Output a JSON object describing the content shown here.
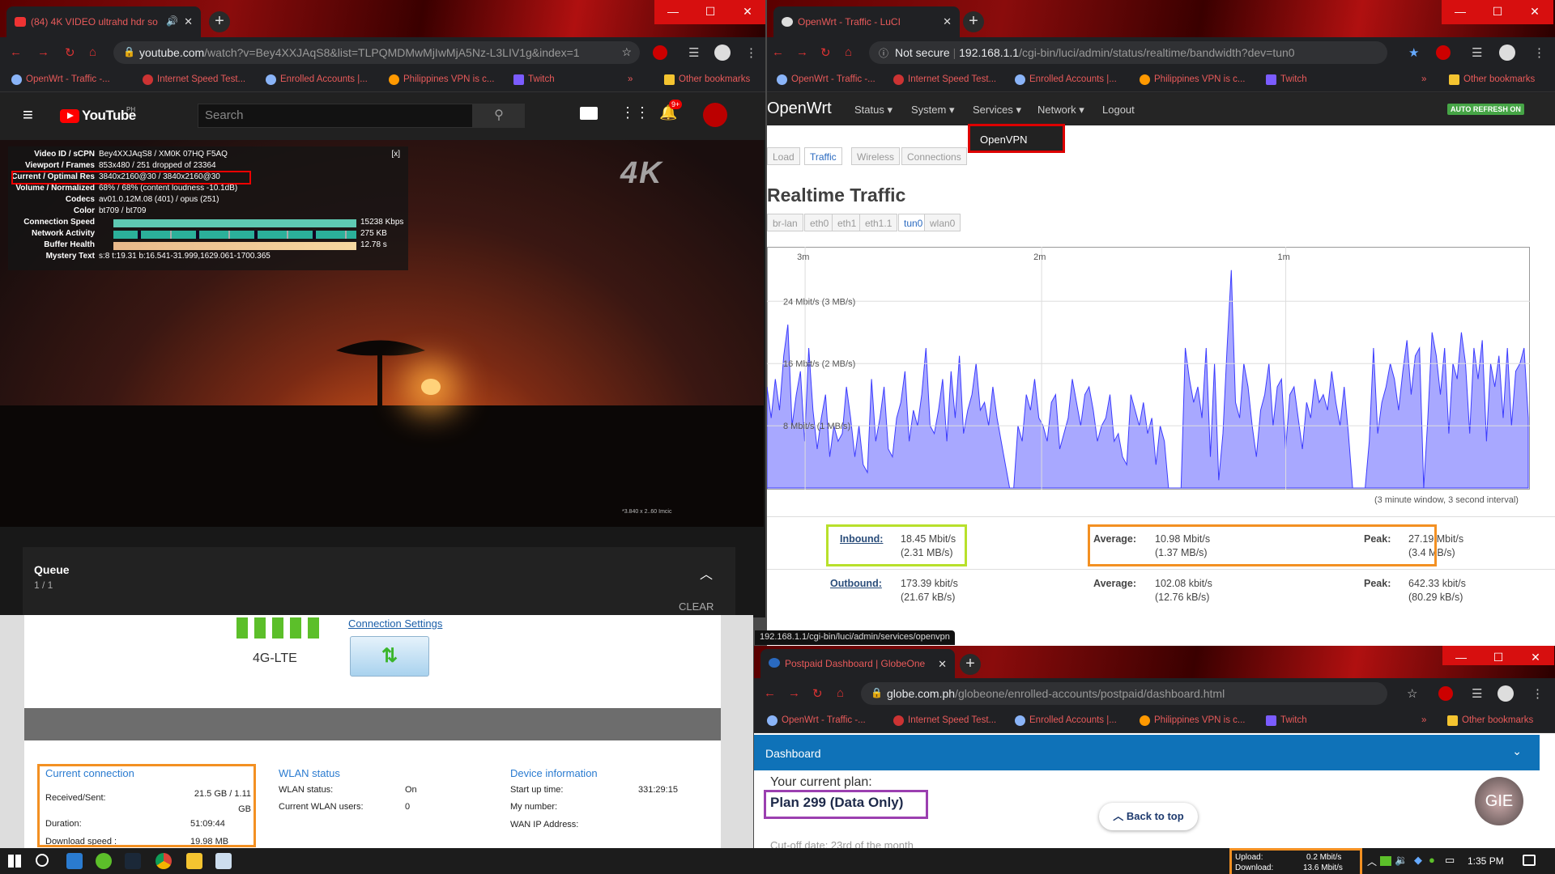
{
  "youtube_window": {
    "tab_title": "(84) 4K VIDEO ultrahd hdr so",
    "url_host": "youtube.com",
    "url_path": "/watch?v=Bey4XXJAqS8&list=TLPQMDMwMjIwMjA5Nz-L3LIV1g&index=1",
    "brand": "YouTube",
    "brand_region": "PH",
    "search_placeholder": "Search",
    "notification_badge": "9+",
    "video_badge": "4K",
    "video_info_close": "[x]",
    "video_footer_note": "*3.840 x 2..60 Imcic",
    "stats": [
      {
        "label": "Video ID / sCPN",
        "value": "Bey4XXJAqS8 / XM0K 07HQ F5AQ"
      },
      {
        "label": "Viewport / Frames",
        "value": "853x480 / 251 dropped of 23364"
      },
      {
        "label": "Current / Optimal Res",
        "value": "3840x2160@30 / 3840x2160@30"
      },
      {
        "label": "Volume / Normalized",
        "value": "68% / 68% (content loudness -10.1dB)"
      },
      {
        "label": "Codecs",
        "value": "av01.0.12M.08 (401) / opus (251)"
      },
      {
        "label": "Color",
        "value": "bt709 / bt709"
      },
      {
        "label": "Connection Speed",
        "value": "15238 Kbps"
      },
      {
        "label": "Network Activity",
        "value": "275 KB"
      },
      {
        "label": "Buffer Health",
        "value": "12.78 s"
      },
      {
        "label": "Mystery Text",
        "value": "s:8 t:19.31 b:16.541-31.999,1629.061-1700.365"
      }
    ],
    "queue_title": "Queue",
    "queue_count": "1 / 1",
    "queue_clear": "CLEAR"
  },
  "bookmarks": [
    "OpenWrt - Traffic -...",
    "Internet Speed Test...",
    "Enrolled Accounts |...",
    "Philippines VPN is c...",
    "Twitch"
  ],
  "other_bookmarks": "Other bookmarks",
  "bookmark_more": "»",
  "router_page": {
    "network_type": "4G-LTE",
    "connection_settings_link": "Connection Settings",
    "current_connection_title": "Current connection",
    "received_sent_label": "Received/Sent:",
    "received_sent_value": "21.5 GB / 1.11 GB",
    "duration_label": "Duration:",
    "duration_value": "51:09:44",
    "download_speed_label": "Download speed :",
    "download_speed_value": "19.98 MB",
    "wlan_title": "WLAN status",
    "wlan_status_label": "WLAN status:",
    "wlan_status_value": "On",
    "wlan_users_label": "Current WLAN users:",
    "wlan_users_value": "0",
    "device_title": "Device information",
    "startup_label": "Start up time:",
    "startup_value": "331:29:15",
    "my_number_label": "My number:",
    "wan_ip_label": "WAN IP Address:"
  },
  "luci_window": {
    "tab_title": "OpenWrt - Traffic - LuCI",
    "not_secure": "Not secure",
    "url_host": "192.168.1.1",
    "url_path": "/cgi-bin/luci/admin/status/realtime/bandwidth?dev=tun0",
    "brand": "OpenWrt",
    "menu": [
      "Status",
      "System",
      "Services",
      "Network",
      "Logout"
    ],
    "auto_refresh": "AUTO REFRESH ON",
    "services_dropdown_item": "OpenVPN",
    "subtabs": [
      "Load",
      "Traffic",
      "Wireless",
      "Connections"
    ],
    "active_subtab": "Traffic",
    "heading": "Realtime Traffic",
    "iface_tabs": [
      "br-lan",
      "eth0",
      "eth1",
      "eth1.1",
      "tun0",
      "wlan0"
    ],
    "active_iface": "tun0",
    "time_labels": [
      "3m",
      "2m",
      "1m"
    ],
    "y_labels": [
      "24 Mbit/s (3 MB/s)",
      "16 Mbit/s (2 MB/s)",
      "8 Mbit/s (1 MB/s)"
    ],
    "window_note": "(3 minute window, 3 second interval)",
    "inbound_label": "Inbound:",
    "inbound_value": "18.45 Mbit/s",
    "inbound_value2": "(2.31 MB/s)",
    "in_avg_label": "Average:",
    "in_avg_value": "10.98 Mbit/s",
    "in_avg_value2": "(1.37 MB/s)",
    "in_peak_label": "Peak:",
    "in_peak_value": "27.19 Mbit/s",
    "in_peak_value2": "(3.4 MB/s)",
    "outbound_label": "Outbound:",
    "outbound_value": "173.39 kbit/s",
    "outbound_value2": "(21.67 kB/s)",
    "out_avg_label": "Average:",
    "out_avg_value": "102.08 kbit/s",
    "out_avg_value2": "(12.76 kB/s)",
    "out_peak_label": "Peak:",
    "out_peak_value": "642.33 kbit/s",
    "out_peak_value2": "(80.29 kB/s)",
    "status_url": "192.168.1.1/cgi-bin/luci/admin/services/openvpn"
  },
  "globe_window": {
    "tab_title": "Postpaid Dashboard | GlobeOne",
    "url_host": "globe.com.ph",
    "url_path": "/globeone/enrolled-accounts/postpaid/dashboard.html",
    "dashboard_label": "Dashboard",
    "current_plan_label": "Your current plan:",
    "plan_name": "Plan 299 (Data Only)",
    "back_to_top": "Back to top",
    "avatar_initials": "GIE",
    "cutoff_text": "Cut-off date: 23rd of the month"
  },
  "taskbar": {
    "upload_label": "Upload:",
    "upload_value": "0.2 Mbit/s",
    "download_label": "Download:",
    "download_value": "13.6 Mbit/s",
    "clock": "1:35 PM"
  },
  "chart_data": {
    "type": "area",
    "title": "",
    "xlabel": "",
    "ylabel": "",
    "x_ticks": [
      "3m",
      "2m",
      "1m"
    ],
    "y_ticks": [
      "8 Mbit/s (1 MB/s)",
      "16 Mbit/s (2 MB/s)",
      "24 Mbit/s (3 MB/s)"
    ],
    "ylim": [
      0,
      31
    ],
    "series": [
      {
        "values": [
          13,
          9,
          14,
          10,
          17,
          21,
          8,
          12,
          15,
          6,
          18,
          10,
          5,
          9,
          12,
          4,
          8,
          6,
          7,
          13,
          9,
          4,
          8,
          3,
          2,
          14,
          6,
          9,
          13,
          5,
          4,
          9,
          11,
          15,
          6,
          10,
          8,
          12,
          18,
          8,
          7,
          10,
          14,
          6,
          15,
          9,
          17,
          7,
          10,
          12,
          16,
          10,
          11,
          8,
          13,
          9,
          6,
          3,
          0,
          0,
          8,
          6,
          12,
          10,
          14,
          9,
          8,
          6,
          11,
          12,
          5,
          7,
          9,
          14,
          11,
          8,
          12,
          13,
          10,
          6,
          8,
          9,
          12,
          6,
          7,
          4,
          3,
          12,
          10,
          8,
          11,
          7,
          9,
          3,
          8,
          6,
          0,
          0,
          0,
          0,
          18,
          14,
          11,
          13,
          9,
          18,
          4,
          16,
          1,
          7,
          18,
          28,
          11,
          9,
          16,
          13,
          8,
          4,
          10,
          12,
          16,
          8,
          13,
          14,
          5,
          12,
          13,
          9,
          5,
          11,
          9,
          14,
          11,
          12,
          10,
          15,
          11,
          8,
          13,
          7,
          0,
          0,
          0,
          0,
          6,
          18,
          7,
          11,
          13,
          16,
          14,
          10,
          15,
          19,
          12,
          17,
          18,
          0,
          9,
          20,
          17,
          12,
          18,
          7,
          16,
          14,
          20,
          16,
          7,
          18,
          14,
          19,
          6,
          16,
          13,
          17,
          9,
          18,
          8,
          15,
          16,
          18,
          9
        ]
      }
    ]
  }
}
